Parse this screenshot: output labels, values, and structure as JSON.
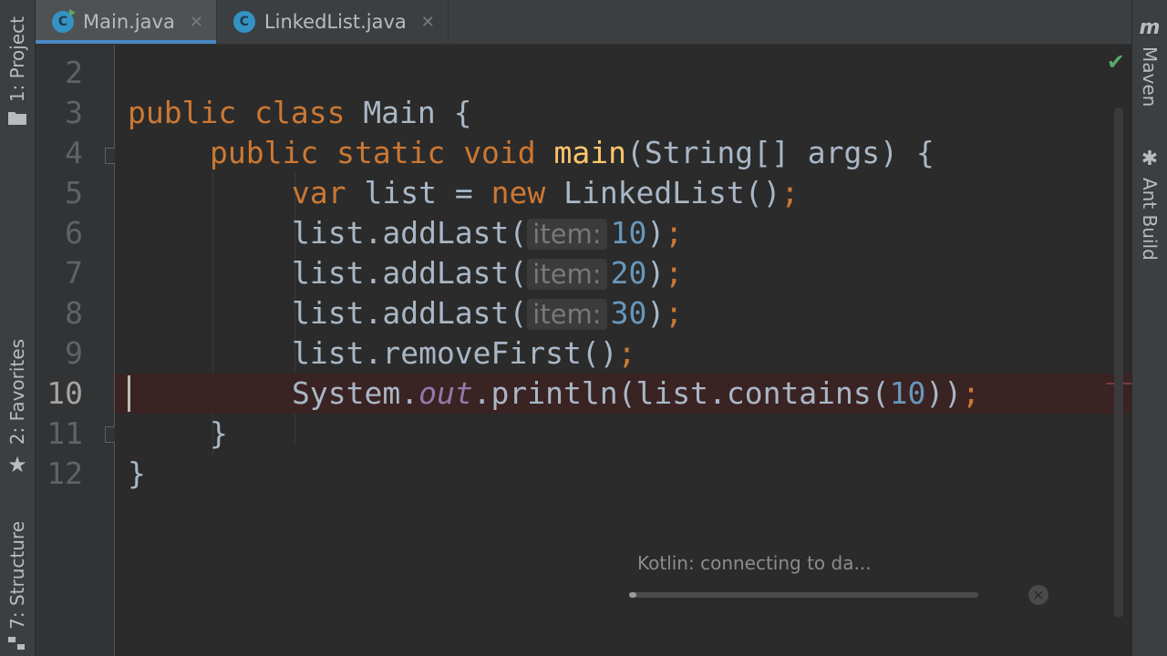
{
  "left_strip": {
    "project": "1: Project",
    "favorites": "2: Favorites",
    "structure": "7: Structure"
  },
  "right_strip": {
    "maven": "Maven",
    "ant_build": "Ant Build"
  },
  "tabs": [
    {
      "label": "Main.java",
      "active": true
    },
    {
      "label": "LinkedList.java",
      "active": false
    }
  ],
  "line_numbers": [
    "2",
    "3",
    "4",
    "5",
    "6",
    "7",
    "8",
    "9",
    "10",
    "11",
    "12"
  ],
  "code": {
    "l3": {
      "kw1": "public",
      "kw2": "class",
      "name": "Main",
      "brace": "{"
    },
    "l4": {
      "kw1": "public",
      "kw2": "static",
      "kw3": "void",
      "method": "main",
      "params": "(String[] args)",
      "brace": "{"
    },
    "l5": {
      "kw": "var",
      "ident": "list",
      "eq": "=",
      "kw_new": "new",
      "ctor": "LinkedList()",
      "semi": ";"
    },
    "l6": {
      "call": "list.addLast(",
      "hint": "item:",
      "num": "10",
      "close": ")",
      "semi": ";"
    },
    "l7": {
      "call": "list.addLast(",
      "hint": "item:",
      "num": "20",
      "close": ")",
      "semi": ";"
    },
    "l8": {
      "call": "list.addLast(",
      "hint": "item:",
      "num": "30",
      "close": ")",
      "semi": ";"
    },
    "l9": {
      "call": "list.removeFirst()",
      "semi": ";"
    },
    "l10": {
      "sys": "System.",
      "field": "out",
      "call": ".println(list.contains(",
      "num": "10",
      "close": "))",
      "semi": ";"
    },
    "l11": {
      "brace": "}"
    },
    "l12": {
      "brace": "}"
    }
  },
  "background_task": {
    "label": "Kotlin: connecting to da...",
    "progress": 0.02
  },
  "colors": {
    "keyword": "#cc7832",
    "method": "#ffc66d",
    "number": "#6897bb",
    "field": "#9876aa",
    "text": "#a9b7c6",
    "accent": "#4a88c7"
  }
}
